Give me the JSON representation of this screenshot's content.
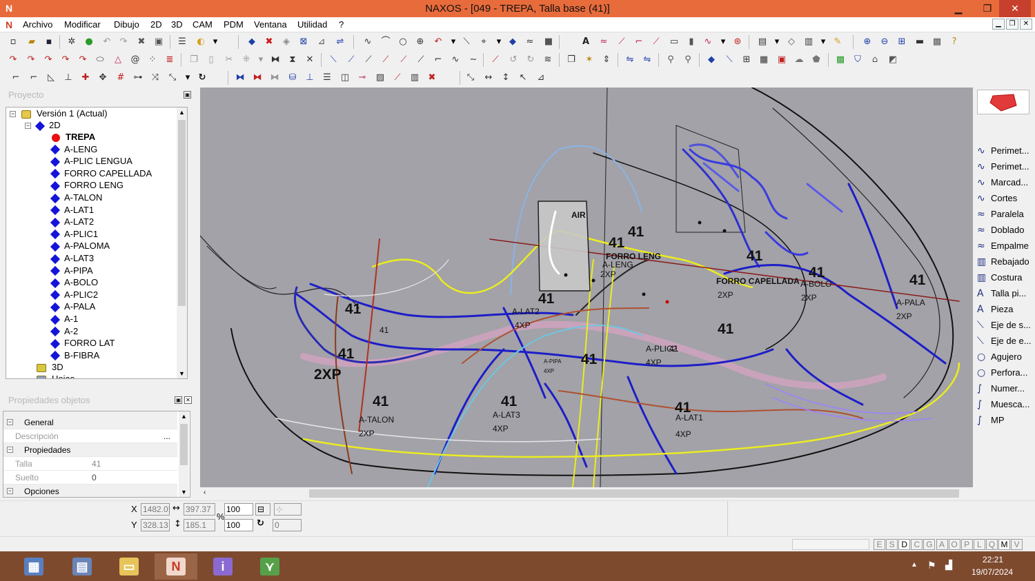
{
  "window": {
    "title": "NAXOS - [049 - TREPA, Talla base (41)]",
    "minimize": "▁",
    "maximize": "❐",
    "close": "✕"
  },
  "menu": [
    "Archivo",
    "Modificar",
    "Dibujo",
    "2D",
    "3D",
    "CAM",
    "PDM",
    "Ventana",
    "Utilidad",
    "?"
  ],
  "project_panel": {
    "title": "Proyecto",
    "root": "Versión 1 (Actual)",
    "node_2d": "2D",
    "items": [
      "TREPA",
      "A-LENG",
      "A-PLIC LENGUA",
      "FORRO CAPELLADA",
      "FORRO LENG",
      "A-TALON",
      "A-LAT1",
      "A-LAT2",
      "A-PLIC1",
      "A-PALOMA",
      "A-LAT3",
      "A-PIPA",
      "A-BOLO",
      "A-PLIC2",
      "A-PALA",
      "A-1",
      "A-2",
      "FORRO LAT",
      "B-FIBRA"
    ],
    "node_3d": "3D",
    "node_hojas": "Hojas"
  },
  "properties_panel": {
    "title": "Propiedades objetos",
    "sections": {
      "general": "General",
      "propiedades": "Propiedades",
      "opciones": "Opciones"
    },
    "descripcion_label": "Descripción",
    "descripcion_btn": "...",
    "talla_label": "Talla",
    "talla_value": "41",
    "suelto_label": "Suelto",
    "suelto_value": "0"
  },
  "right_tools": [
    {
      "label": "Perimet...",
      "icon": "perimeter-icon",
      "glyph": "∿"
    },
    {
      "label": "Perimet...",
      "icon": "perimeter-icon",
      "glyph": "∿"
    },
    {
      "label": "Marcad...",
      "icon": "marker-icon",
      "glyph": "∿"
    },
    {
      "label": "Cortes",
      "icon": "cut-icon",
      "glyph": "∿"
    },
    {
      "label": "Paralela",
      "icon": "parallel-icon",
      "glyph": "≈"
    },
    {
      "label": "Doblado",
      "icon": "fold-icon",
      "glyph": "≈"
    },
    {
      "label": "Empalme",
      "icon": "join-icon",
      "glyph": "≈"
    },
    {
      "label": "Rebajado",
      "icon": "skive-icon",
      "glyph": "▥"
    },
    {
      "label": "Costura",
      "icon": "seam-icon",
      "glyph": "▥"
    },
    {
      "label": "Talla pi...",
      "icon": "text-icon",
      "glyph": "A"
    },
    {
      "label": "Pieza",
      "icon": "text-icon",
      "glyph": "A"
    },
    {
      "label": "Eje de s...",
      "icon": "axis-icon",
      "glyph": "⟍"
    },
    {
      "label": "Eje de e...",
      "icon": "axis-icon",
      "glyph": "⟍"
    },
    {
      "label": "Agujero",
      "icon": "hole-icon",
      "glyph": "○"
    },
    {
      "label": "Perfora...",
      "icon": "perforation-icon",
      "glyph": "○"
    },
    {
      "label": "Numer...",
      "icon": "number-icon",
      "glyph": "∫"
    },
    {
      "label": "Muesca...",
      "icon": "notch-icon",
      "glyph": "∫"
    },
    {
      "label": "MP",
      "icon": "mp-icon",
      "glyph": "∫"
    }
  ],
  "coords": {
    "x_label": "X",
    "y_label": "Y",
    "x": "1482.0!",
    "y": "328.13",
    "dx": "397.37",
    "dy": "185.1",
    "pct_sign": "%",
    "scale_x": "100",
    "scale_y": "100",
    "rotation": "0"
  },
  "status_flags": [
    "E",
    "S",
    "D",
    "C",
    "G",
    "A",
    "O",
    "P",
    "L",
    "Q",
    "M",
    "V"
  ],
  "active_flags": [
    "D",
    "M"
  ],
  "canvas_labels": [
    {
      "text": "41",
      "cls": "big"
    },
    {
      "text": "41",
      "cls": "big"
    },
    {
      "text": "41",
      "cls": "big"
    },
    {
      "text": "41",
      "cls": "big"
    },
    {
      "text": "41",
      "cls": "big"
    },
    {
      "text": "FORRO LENG",
      "cls": "piece"
    },
    {
      "text": "A-LENG",
      "cls": "piece"
    },
    {
      "text": "2XP",
      "cls": "piece"
    },
    {
      "text": "FORRO CAPELLADA",
      "cls": "piece"
    },
    {
      "text": "2XP",
      "cls": "piece"
    },
    {
      "text": "A-BOLO",
      "cls": "piece"
    },
    {
      "text": "2XP",
      "cls": "piece"
    },
    {
      "text": "A-PALA",
      "cls": "piece"
    },
    {
      "text": "2XP",
      "cls": "piece"
    },
    {
      "text": "41",
      "cls": "big"
    },
    {
      "text": "A-LAT2",
      "cls": "piece"
    },
    {
      "text": "4XP",
      "cls": "piece"
    },
    {
      "text": "A-PIPA",
      "cls": "small"
    },
    {
      "text": "4XP",
      "cls": "small"
    },
    {
      "text": "41",
      "cls": "big"
    },
    {
      "text": "A-PLIC2",
      "cls": "piece"
    },
    {
      "text": "41",
      "cls": "piece"
    },
    {
      "text": "4XP",
      "cls": "piece"
    },
    {
      "text": "41",
      "cls": "big"
    },
    {
      "text": "41",
      "cls": "big"
    },
    {
      "text": "A-TALON",
      "cls": "piece"
    },
    {
      "text": "2XP",
      "cls": "piece"
    },
    {
      "text": "41",
      "cls": "big"
    },
    {
      "text": "A-LAT3",
      "cls": "piece"
    },
    {
      "text": "4XP",
      "cls": "piece"
    },
    {
      "text": "41",
      "cls": "big"
    },
    {
      "text": "A-LAT1",
      "cls": "piece"
    },
    {
      "text": "4XP",
      "cls": "piece"
    },
    {
      "text": "41",
      "cls": "big"
    },
    {
      "text": "41",
      "cls": "piece"
    },
    {
      "text": "2XP",
      "cls": "big"
    },
    {
      "text": "41",
      "cls": "big"
    },
    {
      "text": "AIR",
      "cls": "piece"
    }
  ],
  "taskbar": {
    "time": "22:21",
    "date": "19/07/2024",
    "apps": [
      {
        "name": "calculator-app-icon",
        "glyph": "▦",
        "bg": "#5a7fc0"
      },
      {
        "name": "explorer-app-icon",
        "glyph": "▤",
        "bg": "#6a84b8"
      },
      {
        "name": "folder-app-icon",
        "glyph": "▭",
        "bg": "#e7c45a"
      },
      {
        "name": "naxos-app-icon",
        "glyph": "N",
        "bg": "#f2d8cc"
      },
      {
        "name": "pdf-app-icon",
        "glyph": "i",
        "bg": "#8a6ad0"
      },
      {
        "name": "chart-app-icon",
        "glyph": "⋎",
        "bg": "#56a04a"
      }
    ]
  },
  "colors": {
    "titlebar": "#e86b3b",
    "canvas": "#a2a2a8",
    "taskbar": "#7e4a2e",
    "accent_blue": "#1414d8",
    "accent_red": "#e81010"
  }
}
